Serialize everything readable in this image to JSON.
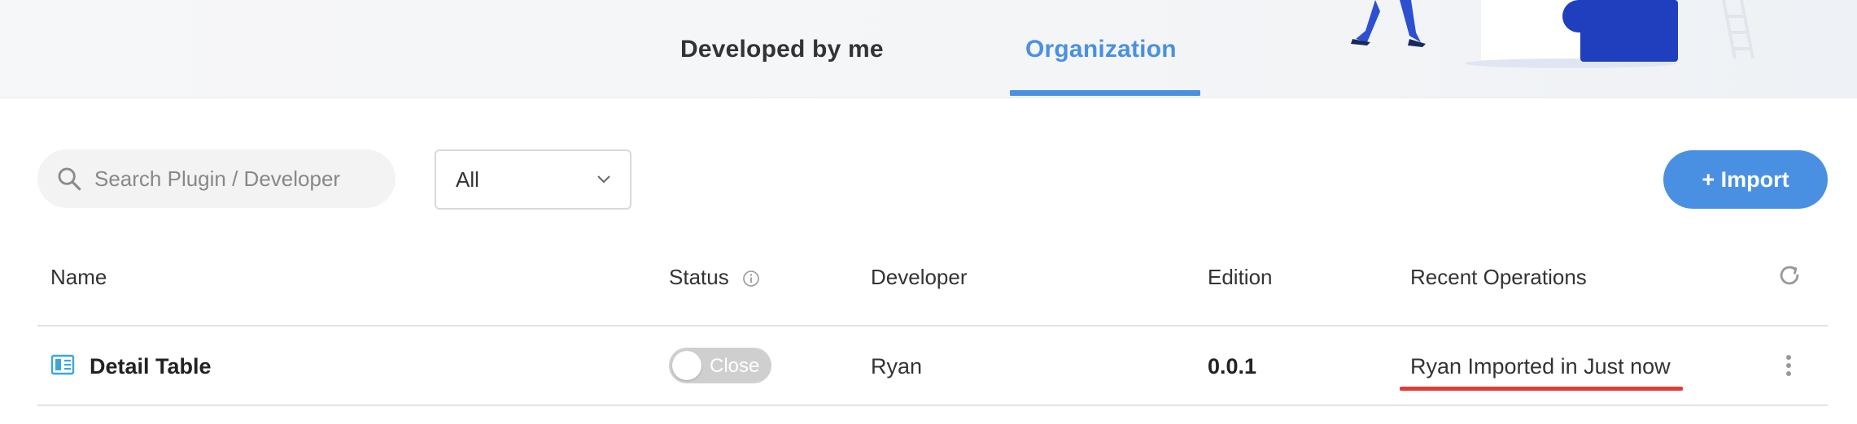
{
  "header": {
    "tabs": [
      {
        "label": "Developed by me",
        "active": false
      },
      {
        "label": "Organization",
        "active": true
      }
    ]
  },
  "toolbar": {
    "search": {
      "placeholder": "Search Plugin / Developer",
      "value": ""
    },
    "filter": {
      "selected": "All"
    },
    "import_label": "+ Import"
  },
  "table": {
    "columns": [
      "Name",
      "Status",
      "Developer",
      "Edition",
      "Recent Operations"
    ],
    "rows": [
      {
        "name": "Detail Table",
        "status": "Close",
        "developer": "Ryan",
        "edition": "0.0.1",
        "recent_operations": "Ryan Imported in Just now"
      }
    ]
  },
  "icons": {
    "search": "search-icon",
    "filter_chevron": "chevron-down-icon",
    "status_info": "info-icon",
    "refresh": "refresh-icon",
    "row_type": "table-layout-icon",
    "more": "more-vertical-icon"
  },
  "colors": {
    "accent": "#4a90e2",
    "highlight_underline": "#e53935",
    "toggle_off": "#cfcfcf"
  }
}
